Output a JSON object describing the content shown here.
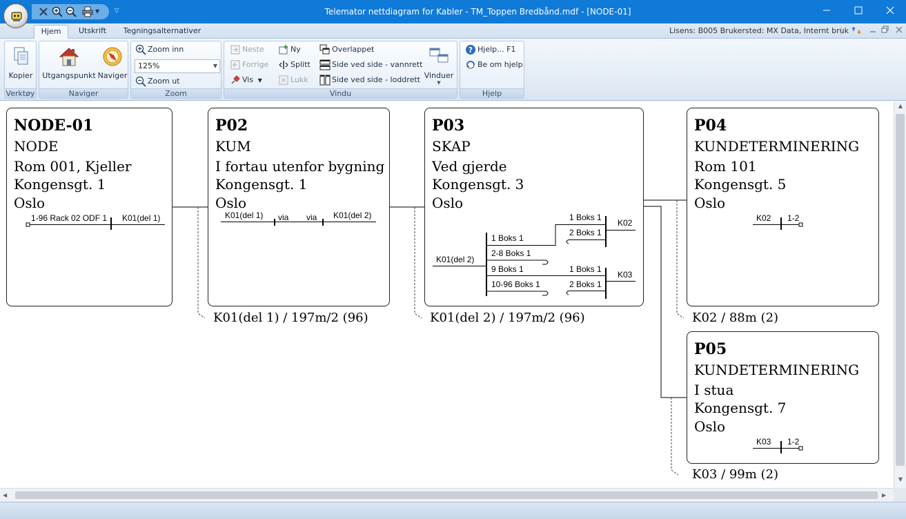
{
  "window": {
    "title": "Telemator nettdiagram for Kabler - TM_Toppen Bredbånd.mdf - [NODE-01]"
  },
  "ribbon": {
    "tabs": [
      {
        "label": "Hjem"
      },
      {
        "label": "Utskrift"
      },
      {
        "label": "Tegningsalternativer"
      }
    ],
    "license": "Lisens: B005 Brukersted: MX Data, Internt bruk",
    "groups": {
      "verktoy": {
        "label": "Verktøy",
        "kopier": "Kopier"
      },
      "naviger": {
        "label": "Naviger",
        "utgangspunkt": "Utgangspunkt",
        "naviger": "Naviger"
      },
      "zoom": {
        "label": "Zoom",
        "zoom_inn": "Zoom inn",
        "zoom_value": "125%",
        "zoom_ut": "Zoom ut"
      },
      "vindu": {
        "label": "Vindu",
        "neste": "Neste",
        "forrige": "Forrige",
        "vis": "Vis",
        "ny": "Ny",
        "splitt": "Splitt",
        "lukk": "Lukk",
        "overlappet": "Overlappet",
        "side_vannrett": "Side ved side - vannrett",
        "side_loddrett": "Side ved side - loddrett",
        "vinduer": "Vinduer"
      },
      "hjelp": {
        "label": "Hjelp",
        "hjelp": "Hjelp... F1",
        "be_om_hjelp": "Be om hjelp"
      }
    }
  },
  "diagram": {
    "nodes": [
      {
        "id": "NODE-01",
        "type": "NODE",
        "location": "Rom 001, Kjeller",
        "address": "Kongensgt. 1",
        "city": "Oslo"
      },
      {
        "id": "P02",
        "type": "KUM",
        "location": "I fortau utenfor bygning",
        "address": "Kongensgt. 1",
        "city": "Oslo"
      },
      {
        "id": "P03",
        "type": "SKAP",
        "location": "Ved gjerde",
        "address": "Kongensgt. 3",
        "city": "Oslo"
      },
      {
        "id": "P04",
        "type": "KUNDETERMINERING",
        "location": "Rom 101",
        "address": "Kongensgt. 5",
        "city": "Oslo"
      },
      {
        "id": "P05",
        "type": "KUNDETERMINERING",
        "location": "I stua",
        "address": "Kongensgt. 7",
        "city": "Oslo"
      }
    ],
    "cable_labels": [
      "K01(del 1) / 197m/2 (96)",
      "K01(del 2) / 197m/2 (96)",
      "K02 / 88m (2)",
      "K03 / 99m (2)"
    ],
    "node01_detail": {
      "odf": "1-96 Rack 02 ODF 1",
      "cable": "K01(del 1)"
    },
    "p02_detail": {
      "cable_in": "K01(del 1)",
      "via1": "via",
      "via2": "via",
      "cable_out": "K01(del 2)"
    },
    "p03_detail": {
      "cable_in": "K01(del 2)",
      "left_boxes": [
        "1 Boks 1",
        "2-8 Boks 1",
        "9 Boks 1",
        "10-96 Boks 1"
      ],
      "right_top": [
        "1 Boks 1",
        "2 Boks 1"
      ],
      "right_bottom": [
        "1 Boks 1",
        "2 Boks 1"
      ],
      "cable_out_top": "K02",
      "cable_out_bottom": "K03"
    },
    "p04_detail": {
      "cable": "K02",
      "range": "1-2"
    },
    "p05_detail": {
      "cable": "K03",
      "range": "1-2"
    }
  }
}
